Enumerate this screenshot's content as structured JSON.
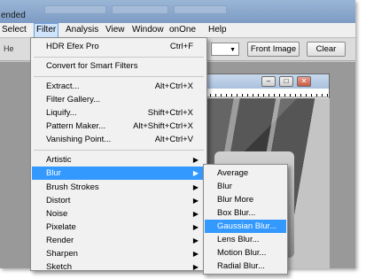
{
  "window": {
    "title": "ended"
  },
  "menubar": {
    "items": [
      {
        "key": "select",
        "label": "Select"
      },
      {
        "key": "filter",
        "label": "Filter"
      },
      {
        "key": "analysis",
        "label": "Analysis"
      },
      {
        "key": "view",
        "label": "View"
      },
      {
        "key": "window",
        "label": "Window"
      },
      {
        "key": "onone",
        "label": "onOne"
      },
      {
        "key": "help",
        "label": "Help"
      }
    ],
    "active": "Filter"
  },
  "options_bar": {
    "hand_label": "He",
    "front_image_label": "Front Image",
    "clear_label": "Clear"
  },
  "filter_menu": {
    "items": [
      {
        "label": "HDR Efex Pro",
        "shortcut": "Ctrl+F"
      },
      {
        "label": "Convert for Smart Filters"
      },
      {
        "label": "Extract...",
        "shortcut": "Alt+Ctrl+X"
      },
      {
        "label": "Filter Gallery..."
      },
      {
        "label": "Liquify...",
        "shortcut": "Shift+Ctrl+X"
      },
      {
        "label": "Pattern Maker...",
        "shortcut": "Alt+Shift+Ctrl+X"
      },
      {
        "label": "Vanishing Point...",
        "shortcut": "Alt+Ctrl+V"
      },
      {
        "label": "Artistic",
        "submenu": true
      },
      {
        "label": "Blur",
        "submenu": true,
        "highlighted": true
      },
      {
        "label": "Brush Strokes",
        "submenu": true
      },
      {
        "label": "Distort",
        "submenu": true
      },
      {
        "label": "Noise",
        "submenu": true
      },
      {
        "label": "Pixelate",
        "submenu": true
      },
      {
        "label": "Render",
        "submenu": true
      },
      {
        "label": "Sharpen",
        "submenu": true
      },
      {
        "label": "Sketch",
        "submenu": true
      }
    ]
  },
  "blur_submenu": {
    "items": [
      {
        "label": "Average"
      },
      {
        "label": "Blur"
      },
      {
        "label": "Blur More"
      },
      {
        "label": "Box Blur..."
      },
      {
        "label": "Gaussian Blur...",
        "highlighted": true
      },
      {
        "label": "Lens Blur..."
      },
      {
        "label": "Motion Blur..."
      },
      {
        "label": "Radial Blur..."
      }
    ]
  },
  "colors": {
    "highlight": "#3399ff",
    "menu_bg": "#f1f1f1",
    "titlebar": "#8ea9cd"
  }
}
